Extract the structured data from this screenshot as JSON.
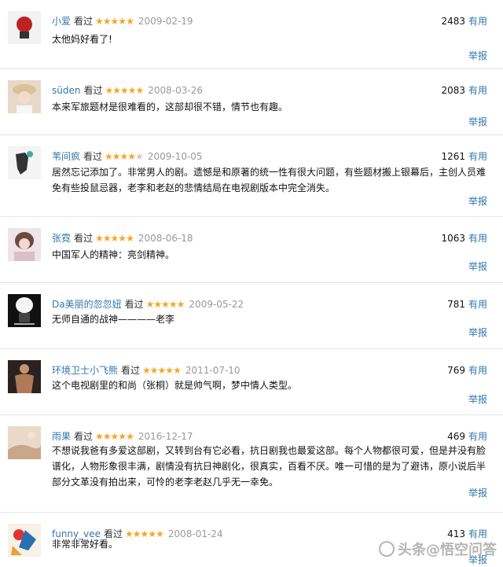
{
  "accent": "#3377aa",
  "star_color": "#f5a623",
  "reviews": [
    {
      "user": "小爱",
      "action": "看过",
      "stars": "★★★★★",
      "stars_off": "",
      "rating": 5,
      "date": "2009-02-19",
      "votes": "2483",
      "useful": "有用",
      "text": "太他妈好看了!",
      "report": "举报"
    },
    {
      "user": "süden",
      "action": "看过",
      "stars": "★★★★★",
      "stars_off": "",
      "rating": 5,
      "date": "2008-03-26",
      "votes": "2083",
      "useful": "有用",
      "text": "本来军旅题材是很难看的，这部却很不错，情节也有趣。",
      "report": "举报"
    },
    {
      "user": "苇间疯",
      "action": "看过",
      "stars": "★★★★",
      "stars_off": "★",
      "rating": 4,
      "date": "2009-10-05",
      "votes": "1261",
      "useful": "有用",
      "text": "居然忘记添加了。非常男人的剧。遗憾是和原著的统一性有很大问题，有些题材搬上银幕后，主创人员难免有些投鼠忌器，老李和老赵的悲情结局在电视剧版本中完全消失。",
      "report": "举报"
    },
    {
      "user": "张霓",
      "action": "看过",
      "stars": "★★★★★",
      "stars_off": "",
      "rating": 5,
      "date": "2008-06-18",
      "votes": "1063",
      "useful": "有用",
      "text": "中国军人的精神：亮剑精神。",
      "report": "举报"
    },
    {
      "user": "Da美丽的忽忽妞",
      "action": "看过",
      "stars": "★★★★★",
      "stars_off": "",
      "rating": 5,
      "date": "2009-05-22",
      "votes": "781",
      "useful": "有用",
      "text": "无师自通的战神————老李",
      "report": "举报"
    },
    {
      "user": "环境卫士小飞熊",
      "action": "看过",
      "stars": "★★★★★",
      "stars_off": "",
      "rating": 5,
      "date": "2011-07-10",
      "votes": "769",
      "useful": "有用",
      "text": "这个电视剧里的和尚（张桐）就是帅气啊，梦中情人类型。",
      "report": "举报"
    },
    {
      "user": "雨果",
      "action": "看过",
      "stars": "★★★★★",
      "stars_off": "",
      "rating": 5,
      "date": "2016-12-17",
      "votes": "469",
      "useful": "有用",
      "text": "不想说我爸有多爱这部剧，又转到台有它必看，抗日剧我也最爱这部。每个人物都很可爱，但是并没有脸谱化，人物形象很丰满，剧情没有抗日神剧化，很真实，百看不厌。唯一可惜的是为了避讳，原小说后半部分文革没有拍出来，可怜的老李老赵几乎无一幸免。",
      "report": "举报"
    },
    {
      "user": "funny_vee",
      "action": "看过",
      "stars": "★★★★★",
      "stars_off": "",
      "rating": 5,
      "date": "2008-01-24",
      "votes": "413",
      "useful": "有用",
      "text": "非常非常好看。",
      "report": "举报"
    }
  ],
  "watermark": "头条@悟空问答"
}
